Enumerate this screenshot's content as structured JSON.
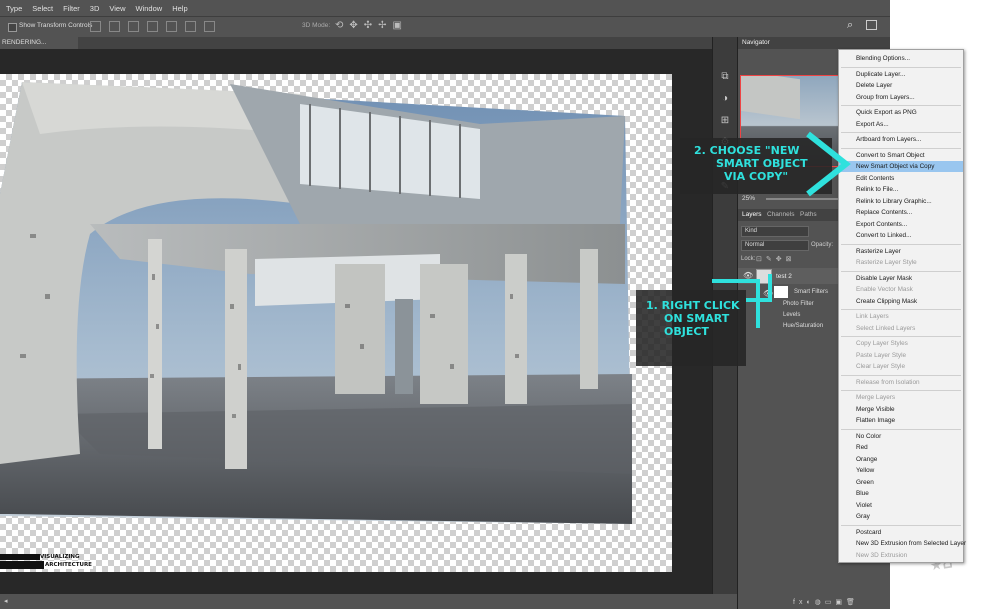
{
  "menubar": {
    "items": [
      "Type",
      "Select",
      "Filter",
      "3D",
      "View",
      "Window",
      "Help"
    ]
  },
  "options": {
    "show_transform": "Show Transform Controls",
    "mode_3d": "3D Mode:"
  },
  "document": {
    "tab_title": "RENDERING..."
  },
  "navigator": {
    "title": "Navigator",
    "zoom": "25%"
  },
  "layers": {
    "tabs": [
      "Layers",
      "Channels",
      "Paths"
    ],
    "kind": "Kind",
    "blend": "Normal",
    "opacity_label": "Opacity:",
    "lock_label": "Lock:",
    "layer_name": "test 2",
    "smart_filters": "Smart Filters",
    "filters": [
      "Photo Filter",
      "Levels",
      "Hue/Saturation"
    ]
  },
  "context_menu": {
    "items": [
      {
        "label": "Blending Options...",
        "disabled": false
      },
      {
        "label": "Duplicate Layer...",
        "disabled": false,
        "sep": true
      },
      {
        "label": "Delete Layer",
        "disabled": false
      },
      {
        "label": "Group from Layers...",
        "disabled": false
      },
      {
        "label": "Quick Export as PNG",
        "disabled": false,
        "sep": true
      },
      {
        "label": "Export As...",
        "disabled": false
      },
      {
        "label": "Artboard from Layers...",
        "disabled": false,
        "sep": true
      },
      {
        "label": "Convert to Smart Object",
        "disabled": false,
        "sep": true
      },
      {
        "label": "New Smart Object via Copy",
        "disabled": false,
        "highlight": true
      },
      {
        "label": "Edit Contents",
        "disabled": false
      },
      {
        "label": "Relink to File...",
        "disabled": false
      },
      {
        "label": "Relink to Library Graphic...",
        "disabled": false
      },
      {
        "label": "Replace Contents...",
        "disabled": false
      },
      {
        "label": "Export Contents...",
        "disabled": false
      },
      {
        "label": "Convert to Linked...",
        "disabled": false
      },
      {
        "label": "Rasterize Layer",
        "disabled": false,
        "sep": true
      },
      {
        "label": "Rasterize Layer Style",
        "disabled": true
      },
      {
        "label": "Disable Layer Mask",
        "disabled": false,
        "sep": true
      },
      {
        "label": "Enable Vector Mask",
        "disabled": true
      },
      {
        "label": "Create Clipping Mask",
        "disabled": false
      },
      {
        "label": "Link Layers",
        "disabled": true,
        "sep": true
      },
      {
        "label": "Select Linked Layers",
        "disabled": true
      },
      {
        "label": "Copy Layer Styles",
        "disabled": true,
        "sep": true
      },
      {
        "label": "Paste Layer Style",
        "disabled": true
      },
      {
        "label": "Clear Layer Style",
        "disabled": true
      },
      {
        "label": "Release from Isolation",
        "disabled": true,
        "sep": true
      },
      {
        "label": "Merge Layers",
        "disabled": true,
        "sep": true
      },
      {
        "label": "Merge Visible",
        "disabled": false
      },
      {
        "label": "Flatten Image",
        "disabled": false
      },
      {
        "label": "No Color",
        "disabled": false,
        "sep": true
      },
      {
        "label": "Red",
        "disabled": false
      },
      {
        "label": "Orange",
        "disabled": false
      },
      {
        "label": "Yellow",
        "disabled": false
      },
      {
        "label": "Green",
        "disabled": false
      },
      {
        "label": "Blue",
        "disabled": false
      },
      {
        "label": "Violet",
        "disabled": false
      },
      {
        "label": "Gray",
        "disabled": false
      },
      {
        "label": "Postcard",
        "disabled": false,
        "sep": true
      },
      {
        "label": "New 3D Extrusion from Selected Layer",
        "disabled": false
      },
      {
        "label": "New 3D Extrusion",
        "disabled": true
      }
    ]
  },
  "annotations": {
    "step2": [
      "2.  CHOOSE \"NEW",
      "SMART OBJECT",
      "VIA COPY\""
    ],
    "step1": [
      "1.  RIGHT CLICK",
      "ON SMART",
      "OBJECT"
    ],
    "accent": "#2fe1dd"
  },
  "logo": {
    "line1": "VISUALIZING",
    "line2": "ARCHITECTURE"
  }
}
